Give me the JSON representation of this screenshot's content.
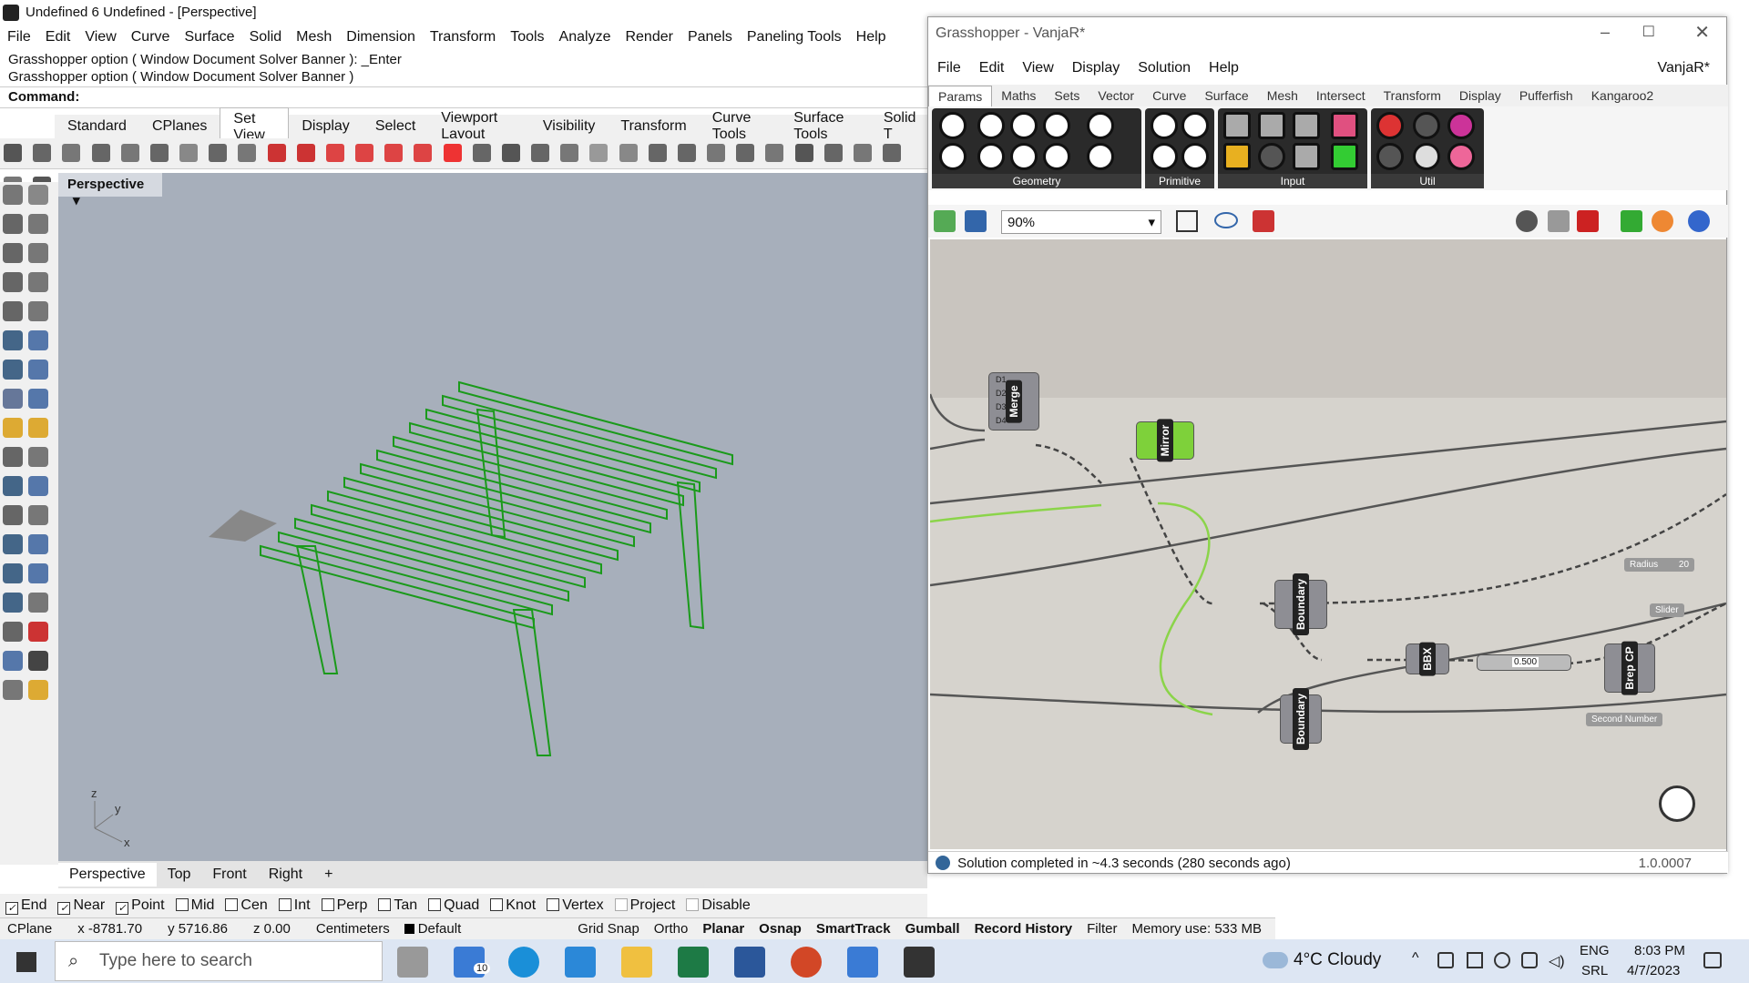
{
  "window": {
    "title": "Undefined 6 Undefined - [Perspective]"
  },
  "menu": [
    "File",
    "Edit",
    "View",
    "Curve",
    "Surface",
    "Solid",
    "Mesh",
    "Dimension",
    "Transform",
    "Tools",
    "Analyze",
    "Render",
    "Panels",
    "Paneling Tools",
    "Help"
  ],
  "command_history": [
    "Grasshopper option ( Window  Document  Solver  Banner ): _Enter",
    "Grasshopper option ( Window  Document  Solver  Banner )"
  ],
  "command_prompt": "Command:",
  "toolbar_tabs": [
    "Standard",
    "CPlanes",
    "Set View",
    "Display",
    "Select",
    "Viewport Layout",
    "Visibility",
    "Transform",
    "Curve Tools",
    "Surface Tools",
    "Solid T"
  ],
  "active_toolbar_tab": "Set View",
  "viewport": {
    "name": "Perspective",
    "axis_labels": [
      "z",
      "y",
      "x"
    ]
  },
  "viewport_tabs": [
    "Perspective",
    "Top",
    "Front",
    "Right"
  ],
  "osnaps": [
    {
      "label": "End",
      "checked": true
    },
    {
      "label": "Near",
      "checked": true
    },
    {
      "label": "Point",
      "checked": true
    },
    {
      "label": "Mid",
      "checked": false
    },
    {
      "label": "Cen",
      "checked": false
    },
    {
      "label": "Int",
      "checked": false
    },
    {
      "label": "Perp",
      "checked": false
    },
    {
      "label": "Tan",
      "checked": false
    },
    {
      "label": "Quad",
      "checked": false
    },
    {
      "label": "Knot",
      "checked": false
    },
    {
      "label": "Vertex",
      "checked": false
    },
    {
      "label": "Project",
      "checked": false
    },
    {
      "label": "Disable",
      "checked": false
    }
  ],
  "status": {
    "cplane": "CPlane",
    "x": "x -8781.70",
    "y": "y 5716.86",
    "z": "z 0.00",
    "units": "Centimeters",
    "layer": "Default",
    "items": [
      "Grid Snap",
      "Ortho",
      "Planar",
      "Osnap",
      "SmartTrack",
      "Gumball",
      "Record History",
      "Filter"
    ],
    "memory": "Memory use: 533 MB"
  },
  "taskbar": {
    "search_placeholder": "Type here to search",
    "weather": "4°C  Cloudy",
    "lang1": "ENG",
    "lang2": "SRL",
    "time": "8:03 PM",
    "date": "4/7/2023",
    "mail_badge": "10"
  },
  "grasshopper": {
    "title": "Grasshopper - VanjaR*",
    "doc_name": "VanjaR*",
    "menu": [
      "File",
      "Edit",
      "View",
      "Display",
      "Solution",
      "Help"
    ],
    "tabs": [
      "Params",
      "Maths",
      "Sets",
      "Vector",
      "Curve",
      "Surface",
      "Mesh",
      "Intersect",
      "Transform",
      "Display",
      "Pufferfish",
      "Kangaroo2"
    ],
    "ribbon_groups": [
      "Geometry",
      "Primitive",
      "Input",
      "Util"
    ],
    "zoom": "90%",
    "components": {
      "merge": "Merge",
      "mirror": "Mirror",
      "boundary1": "Boundary",
      "boundary2": "Boundary",
      "bbx": "BBX",
      "brepcp": "Brep CP",
      "slider_value": "0.500",
      "radius": "Radius",
      "radius_val": "20",
      "slider": "Slider",
      "second_number": "Second Number"
    },
    "merge_inputs": [
      "D1",
      "D2",
      "D3",
      "D4"
    ],
    "status": "Solution completed in ~4.3 seconds (280 seconds ago)",
    "version": "1.0.0007"
  }
}
